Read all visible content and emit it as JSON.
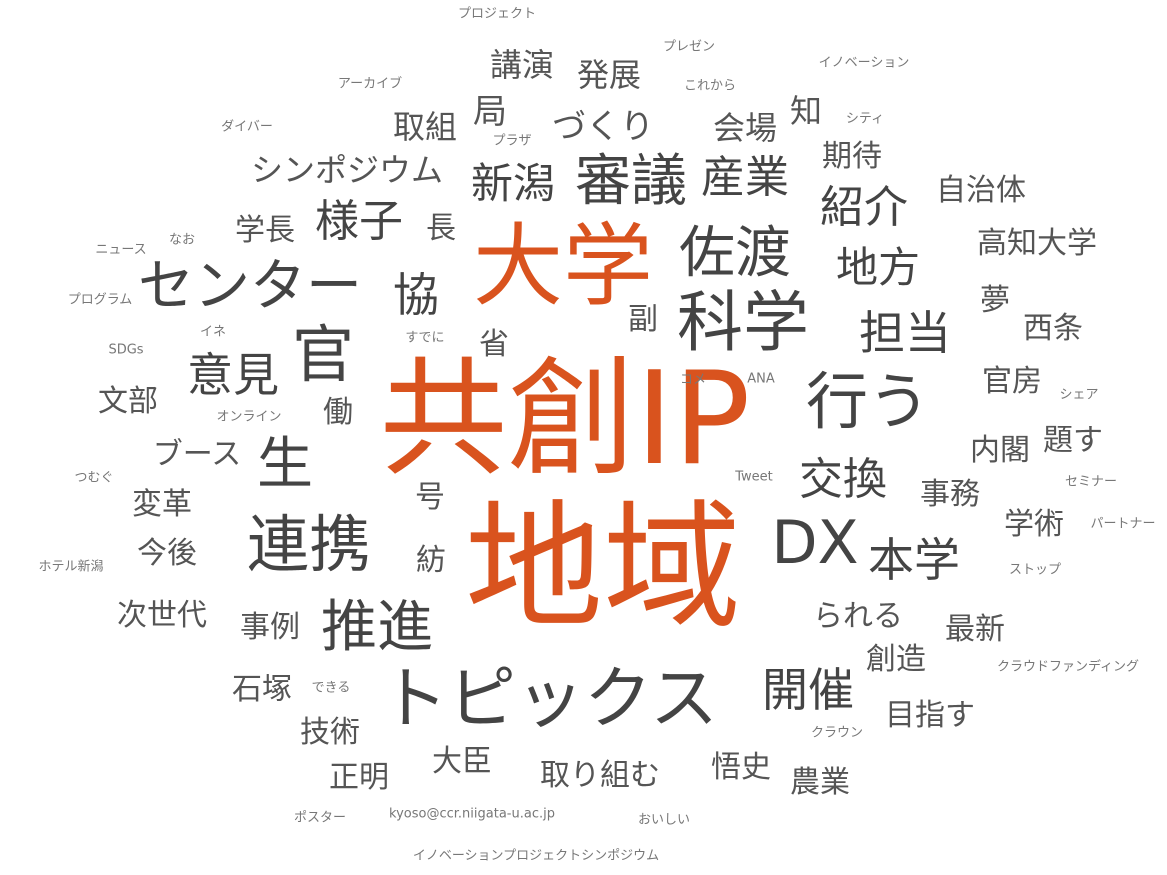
{
  "chart_data": {
    "type": "wordcloud",
    "colors": {
      "highlight": "#d9531e",
      "primary": "#444444",
      "secondary": "#555555",
      "minor": "#777777"
    },
    "words": [
      {
        "text": "共創IP",
        "weight": 100,
        "color": "#d9531e"
      },
      {
        "text": "地域",
        "weight": 100,
        "color": "#d9531e"
      },
      {
        "text": "大学",
        "weight": 70,
        "color": "#d9531e"
      },
      {
        "text": "トピックス",
        "weight": 55,
        "color": "#444444"
      },
      {
        "text": "科学",
        "weight": 55,
        "color": "#444444"
      },
      {
        "text": "連携",
        "weight": 50,
        "color": "#444444"
      },
      {
        "text": "行う",
        "weight": 50,
        "color": "#444444"
      },
      {
        "text": "DX",
        "weight": 50,
        "color": "#444444"
      },
      {
        "text": "官",
        "weight": 50,
        "color": "#444444"
      },
      {
        "text": "審議",
        "weight": 45,
        "color": "#444444"
      },
      {
        "text": "佐渡",
        "weight": 45,
        "color": "#444444"
      },
      {
        "text": "センター",
        "weight": 45,
        "color": "#444444"
      },
      {
        "text": "推進",
        "weight": 45,
        "color": "#444444"
      },
      {
        "text": "生",
        "weight": 45,
        "color": "#444444"
      },
      {
        "text": "産業",
        "weight": 35,
        "color": "#444444"
      },
      {
        "text": "紹介",
        "weight": 35,
        "color": "#444444"
      },
      {
        "text": "様子",
        "weight": 35,
        "color": "#444444"
      },
      {
        "text": "交換",
        "weight": 35,
        "color": "#444444"
      },
      {
        "text": "新潟",
        "weight": 35,
        "color": "#444444"
      },
      {
        "text": "地方",
        "weight": 35,
        "color": "#444444"
      },
      {
        "text": "協",
        "weight": 35,
        "color": "#444444"
      },
      {
        "text": "担当",
        "weight": 35,
        "color": "#444444"
      },
      {
        "text": "意見",
        "weight": 35,
        "color": "#444444"
      },
      {
        "text": "本学",
        "weight": 35,
        "color": "#444444"
      },
      {
        "text": "開催",
        "weight": 35,
        "color": "#444444"
      },
      {
        "text": "局",
        "weight": 25,
        "color": "#555555"
      },
      {
        "text": "づくり",
        "weight": 25,
        "color": "#555555"
      },
      {
        "text": "知",
        "weight": 25,
        "color": "#555555"
      },
      {
        "text": "シンポジウム",
        "weight": 25,
        "color": "#555555"
      },
      {
        "text": "講演",
        "weight": 22,
        "color": "#555555"
      },
      {
        "text": "発展",
        "weight": 22,
        "color": "#555555"
      },
      {
        "text": "取組",
        "weight": 22,
        "color": "#555555"
      },
      {
        "text": "会場",
        "weight": 22,
        "color": "#555555"
      },
      {
        "text": "期待",
        "weight": 22,
        "color": "#555555"
      },
      {
        "text": "自治体",
        "weight": 22,
        "color": "#555555"
      },
      {
        "text": "学長",
        "weight": 22,
        "color": "#555555"
      },
      {
        "text": "長",
        "weight": 22,
        "color": "#555555"
      },
      {
        "text": "高知大学",
        "weight": 22,
        "color": "#555555"
      },
      {
        "text": "夢",
        "weight": 22,
        "color": "#555555"
      },
      {
        "text": "西条",
        "weight": 22,
        "color": "#555555"
      },
      {
        "text": "副",
        "weight": 22,
        "color": "#555555"
      },
      {
        "text": "省",
        "weight": 22,
        "color": "#555555"
      },
      {
        "text": "文部",
        "weight": 22,
        "color": "#555555"
      },
      {
        "text": "官房",
        "weight": 22,
        "color": "#555555"
      },
      {
        "text": "働",
        "weight": 22,
        "color": "#555555"
      },
      {
        "text": "内閣",
        "weight": 22,
        "color": "#555555"
      },
      {
        "text": "題す",
        "weight": 22,
        "color": "#555555"
      },
      {
        "text": "ブース",
        "weight": 22,
        "color": "#555555"
      },
      {
        "text": "事務",
        "weight": 22,
        "color": "#555555"
      },
      {
        "text": "変革",
        "weight": 22,
        "color": "#555555"
      },
      {
        "text": "号",
        "weight": 22,
        "color": "#555555"
      },
      {
        "text": "学術",
        "weight": 22,
        "color": "#555555"
      },
      {
        "text": "今後",
        "weight": 22,
        "color": "#555555"
      },
      {
        "text": "紡",
        "weight": 22,
        "color": "#555555"
      },
      {
        "text": "次世代",
        "weight": 22,
        "color": "#555555"
      },
      {
        "text": "事例",
        "weight": 22,
        "color": "#555555"
      },
      {
        "text": "られる",
        "weight": 22,
        "color": "#555555"
      },
      {
        "text": "最新",
        "weight": 22,
        "color": "#555555"
      },
      {
        "text": "創造",
        "weight": 22,
        "color": "#555555"
      },
      {
        "text": "石塚",
        "weight": 22,
        "color": "#555555"
      },
      {
        "text": "目指す",
        "weight": 22,
        "color": "#555555"
      },
      {
        "text": "技術",
        "weight": 22,
        "color": "#555555"
      },
      {
        "text": "正明",
        "weight": 22,
        "color": "#555555"
      },
      {
        "text": "大臣",
        "weight": 22,
        "color": "#555555"
      },
      {
        "text": "取り組む",
        "weight": 22,
        "color": "#555555"
      },
      {
        "text": "悟史",
        "weight": 22,
        "color": "#555555"
      },
      {
        "text": "農業",
        "weight": 22,
        "color": "#555555"
      },
      {
        "text": "プロジェクト",
        "weight": 8,
        "color": "#777777"
      },
      {
        "text": "プレゼン",
        "weight": 8,
        "color": "#777777"
      },
      {
        "text": "イノベーション",
        "weight": 8,
        "color": "#777777"
      },
      {
        "text": "アーカイブ",
        "weight": 8,
        "color": "#777777"
      },
      {
        "text": "これから",
        "weight": 8,
        "color": "#777777"
      },
      {
        "text": "シティ",
        "weight": 8,
        "color": "#777777"
      },
      {
        "text": "ダイバー",
        "weight": 8,
        "color": "#777777"
      },
      {
        "text": "プラザ",
        "weight": 8,
        "color": "#777777"
      },
      {
        "text": "ニュース",
        "weight": 8,
        "color": "#777777"
      },
      {
        "text": "なお",
        "weight": 8,
        "color": "#777777"
      },
      {
        "text": "プログラム",
        "weight": 8,
        "color": "#777777"
      },
      {
        "text": "イネ",
        "weight": 8,
        "color": "#777777"
      },
      {
        "text": "すでに",
        "weight": 8,
        "color": "#777777"
      },
      {
        "text": "SDGs",
        "weight": 8,
        "color": "#777777"
      },
      {
        "text": "コメ",
        "weight": 8,
        "color": "#777777"
      },
      {
        "text": "ANA",
        "weight": 8,
        "color": "#777777"
      },
      {
        "text": "シェア",
        "weight": 8,
        "color": "#777777"
      },
      {
        "text": "オンライン",
        "weight": 8,
        "color": "#777777"
      },
      {
        "text": "つむぐ",
        "weight": 8,
        "color": "#777777"
      },
      {
        "text": "Tweet",
        "weight": 8,
        "color": "#777777"
      },
      {
        "text": "セミナー",
        "weight": 8,
        "color": "#777777"
      },
      {
        "text": "パートナー",
        "weight": 8,
        "color": "#777777"
      },
      {
        "text": "ホテル新潟",
        "weight": 8,
        "color": "#777777"
      },
      {
        "text": "ストップ",
        "weight": 8,
        "color": "#777777"
      },
      {
        "text": "クラウドファンディング",
        "weight": 8,
        "color": "#777777"
      },
      {
        "text": "できる",
        "weight": 8,
        "color": "#777777"
      },
      {
        "text": "クラウン",
        "weight": 8,
        "color": "#777777"
      },
      {
        "text": "ポスター",
        "weight": 8,
        "color": "#777777"
      },
      {
        "text": "kyoso@ccr.niigata-u.ac.jp",
        "weight": 8,
        "color": "#777777"
      },
      {
        "text": "おいしい",
        "weight": 8,
        "color": "#777777"
      },
      {
        "text": "イノベーションプロジェクトシンポジウム",
        "weight": 8,
        "color": "#777777"
      }
    ]
  }
}
